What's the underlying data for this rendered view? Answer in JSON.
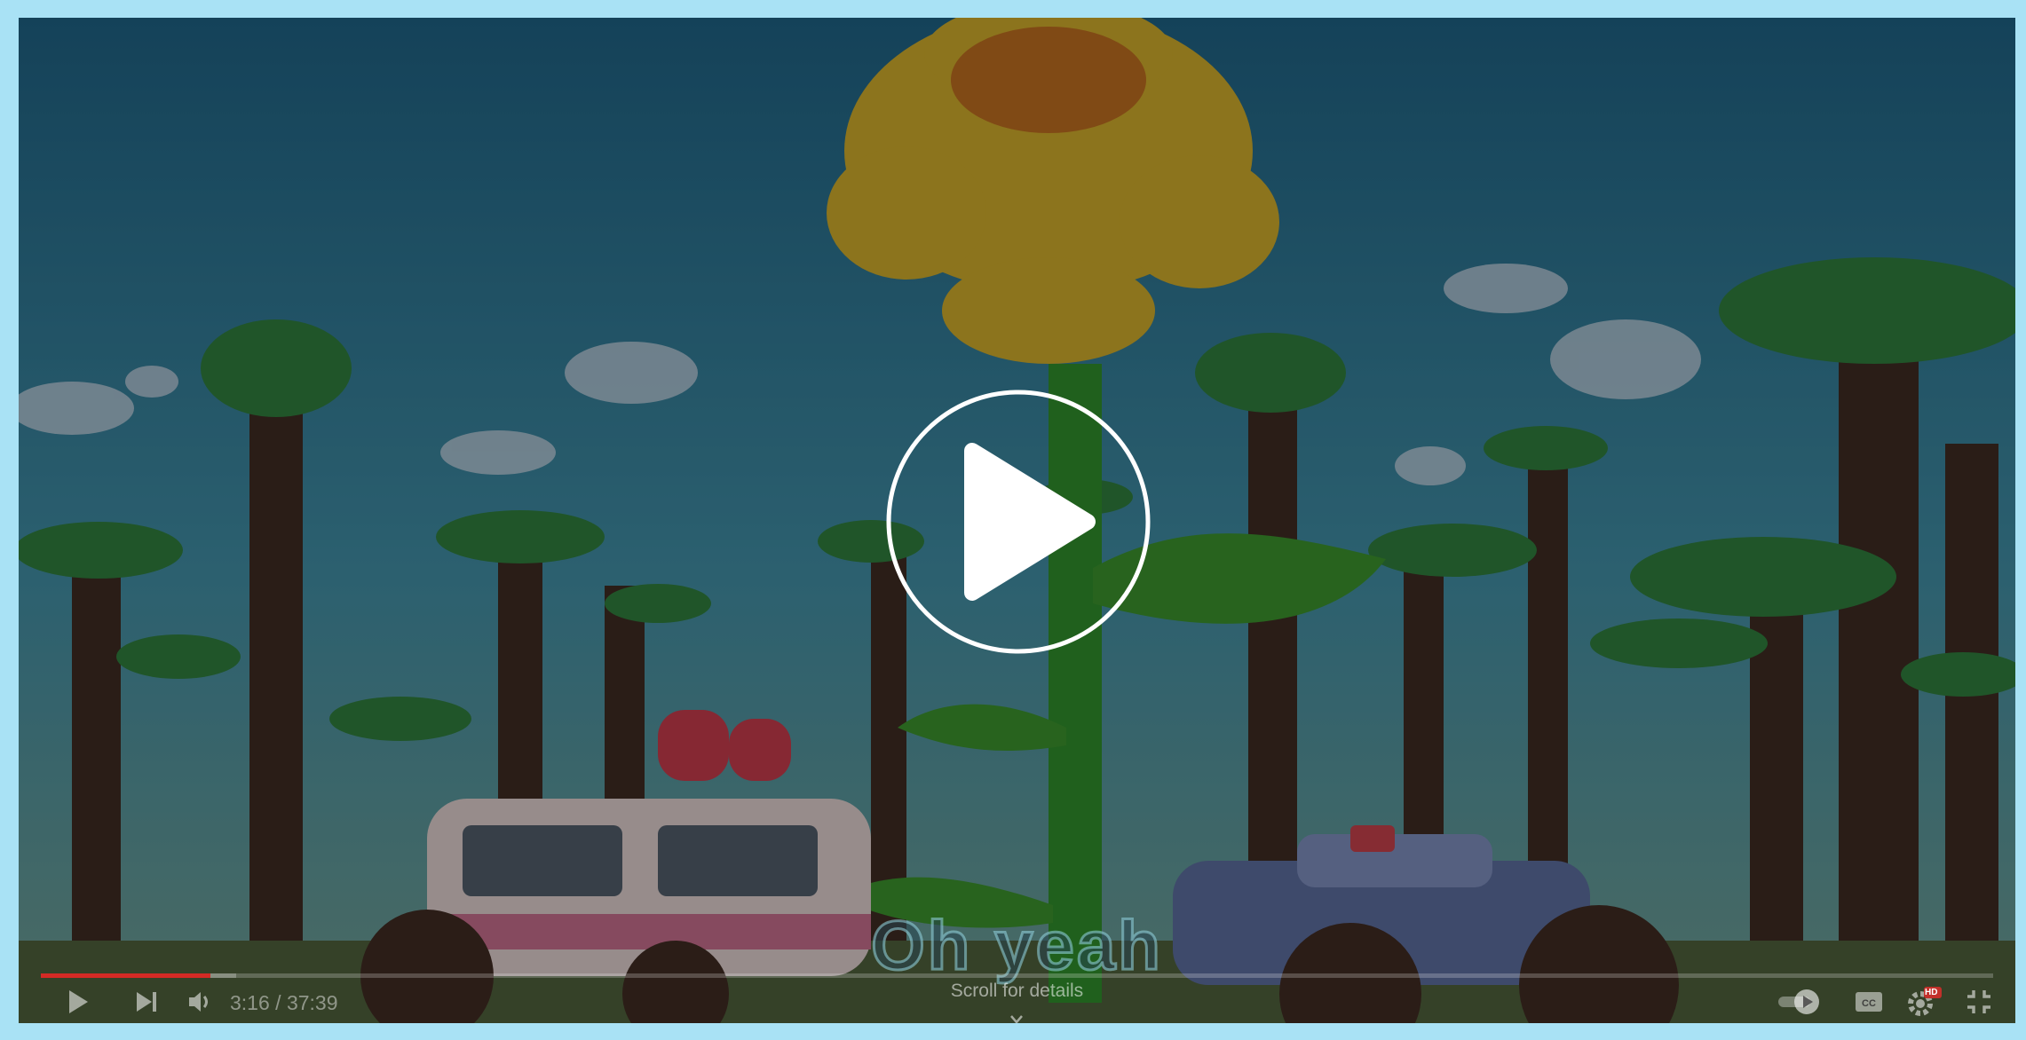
{
  "player": {
    "caption": "Oh yeah",
    "time_current": "3:16",
    "time_total": "37:39",
    "progress": 0.087,
    "buffered": 0.1,
    "scroll_hint": "Scroll for details",
    "quality_badge": "HD"
  },
  "icons": {
    "big_play": "play-circle-icon",
    "play": "play-icon",
    "next": "skip-next-icon",
    "volume": "volume-icon",
    "autoplay": "autoplay-toggle-icon",
    "captions": "closed-captions-icon",
    "settings": "gear-icon",
    "exit_fullscreen": "exit-fullscreen-icon",
    "scroll": "chevron-down-icon"
  },
  "colors": {
    "progress": "#d42a25",
    "frame": "#a9e2f5"
  }
}
